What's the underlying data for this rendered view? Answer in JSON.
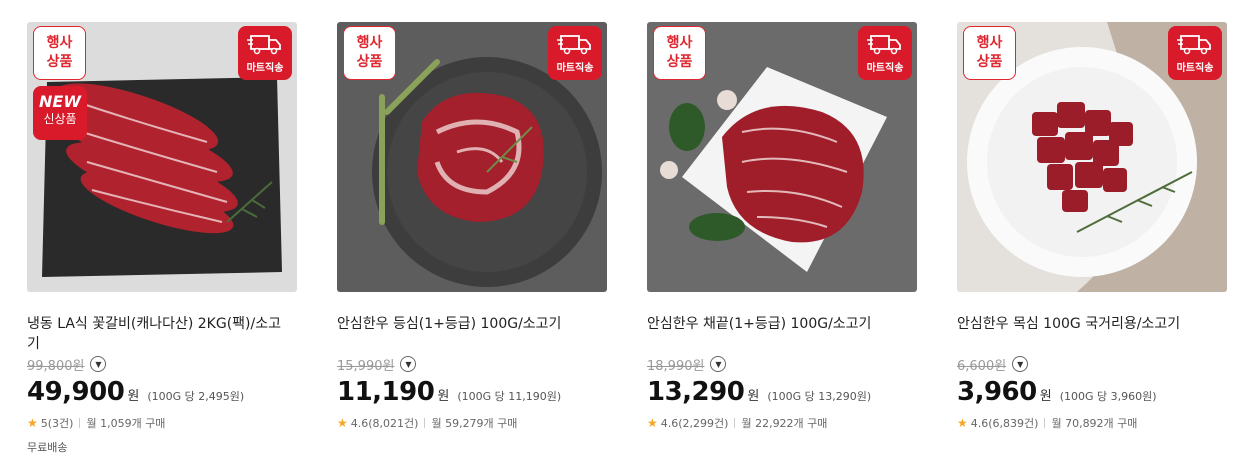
{
  "products": [
    {
      "badge_event": [
        "행사",
        "상품"
      ],
      "badge_ship": "마트직송",
      "badge_new": {
        "top": "NEW",
        "bottom": "신상품"
      },
      "title_lines": [
        "냉동 LA식 꽃갈비(캐나다산) 2KG(팩)/소고",
        "기"
      ],
      "original_price": "99,800",
      "original_unit": "원",
      "price": "49,900",
      "price_unit": "원",
      "unit_price": "(100G 당 2,495원)",
      "rating": "5(3건)",
      "purchases": "월 1,059개 구매",
      "free_shipping": "무료배송"
    },
    {
      "badge_event": [
        "행사",
        "상품"
      ],
      "badge_ship": "마트직송",
      "title_lines": [
        "안심한우 등심(1+등급) 100G/소고기",
        ""
      ],
      "original_price": "15,990",
      "original_unit": "원",
      "price": "11,190",
      "price_unit": "원",
      "unit_price": "(100G 당 11,190원)",
      "rating": "4.6(8,021건)",
      "purchases": "월 59,279개 구매"
    },
    {
      "badge_event": [
        "행사",
        "상품"
      ],
      "badge_ship": "마트직송",
      "title_lines": [
        "안심한우 채끝(1+등급) 100G/소고기",
        ""
      ],
      "original_price": "18,990",
      "original_unit": "원",
      "price": "13,290",
      "price_unit": "원",
      "unit_price": "(100G 당 13,290원)",
      "rating": "4.6(2,299건)",
      "purchases": "월 22,922개 구매"
    },
    {
      "badge_event": [
        "행사",
        "상품"
      ],
      "badge_ship": "마트직송",
      "title_lines": [
        "안심한우 목심 100G 국거리용/소고기",
        ""
      ],
      "original_price": "6,600",
      "original_unit": "원",
      "price": "3,960",
      "price_unit": "원",
      "unit_price": "(100G 당 3,960원)",
      "rating": "4.6(6,839건)",
      "purchases": "월 70,892개 구매"
    }
  ],
  "icons": {
    "star": "star-icon",
    "chevron": "chevron-down-icon",
    "truck": "truck-icon"
  },
  "colors": {
    "brand_red": "#d91a2a",
    "star": "#f5a623"
  }
}
